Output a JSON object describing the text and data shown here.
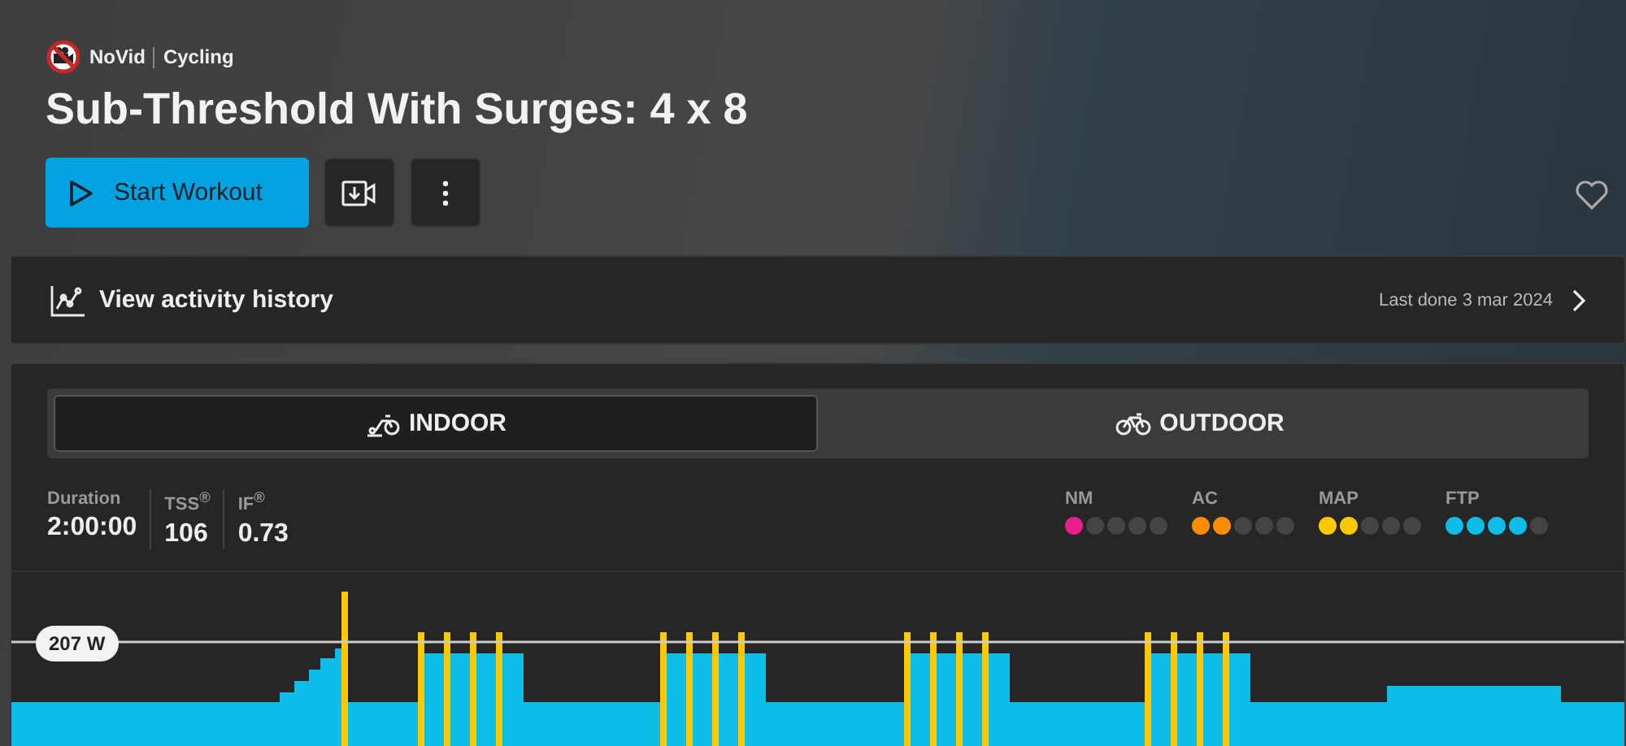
{
  "brand": {
    "badge": "NoVid",
    "category": "Cycling"
  },
  "title": "Sub-Threshold With Surges: 4 x 8",
  "actions": {
    "start": "Start Workout"
  },
  "favorited": false,
  "history": {
    "label": "View activity history",
    "last_done": "Last done 3 mar 2024"
  },
  "modes": [
    {
      "label": "INDOOR",
      "kind": "indoor",
      "selected": true
    },
    {
      "label": "OUTDOOR",
      "kind": "outdoor",
      "selected": false
    }
  ],
  "stats": [
    {
      "label": "Duration",
      "value": "2:00:00"
    },
    {
      "label": "TSS$^{®}$",
      "value": "106"
    },
    {
      "label": "IF$^{®}$",
      "value": "0.73"
    }
  ],
  "ratings": [
    {
      "zone": "NM",
      "stars": 1,
      "color": "#e91e8c"
    },
    {
      "zone": "AC",
      "stars": 2,
      "color": "#ff8c00"
    },
    {
      "zone": "MAP",
      "stars": 2,
      "color": "#ffc800"
    },
    {
      "zone": "FTP",
      "stars": 4,
      "color": "#0dbde8"
    }
  ],
  "ftp_marker": "207 W"
}
